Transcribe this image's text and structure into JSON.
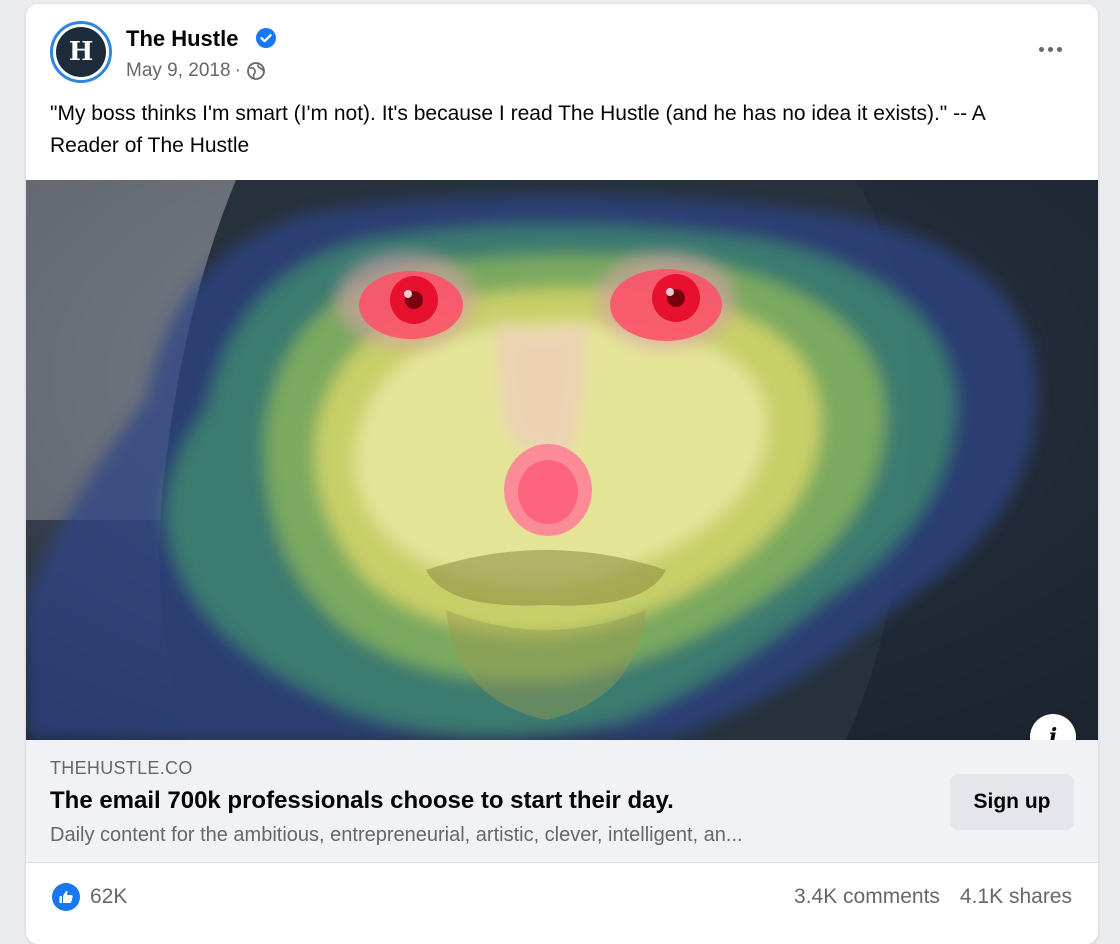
{
  "post": {
    "page_name": "The Hustle",
    "avatar_letter": "H",
    "date": "May 9, 2018",
    "separator": "·",
    "text": "\"My boss thinks I'm smart (I'm not). It's because I read The Hustle (and he has no idea it exists).\" -- A Reader of The Hustle"
  },
  "link_preview": {
    "domain": "THEHUSTLE.CO",
    "title": "The email 700k professionals choose to start their day.",
    "description": "Daily content for the ambitious, entrepreneurial, artistic, clever, intelligent, an...",
    "cta_label": "Sign up",
    "info_label": "i"
  },
  "engagement": {
    "likes": "62K",
    "comments": "3.4K comments",
    "shares": "4.1K shares"
  },
  "colors": {
    "verified": "#1877f2",
    "like": "#1877f2",
    "heat_low": "#3a4a8a",
    "heat_mid": "#4f9a6a",
    "heat_high": "#e8e060",
    "heat_peak": "#ff3b5a"
  },
  "icons": [
    "verified-icon",
    "globe-icon",
    "more-icon",
    "info-icon",
    "like-icon"
  ]
}
